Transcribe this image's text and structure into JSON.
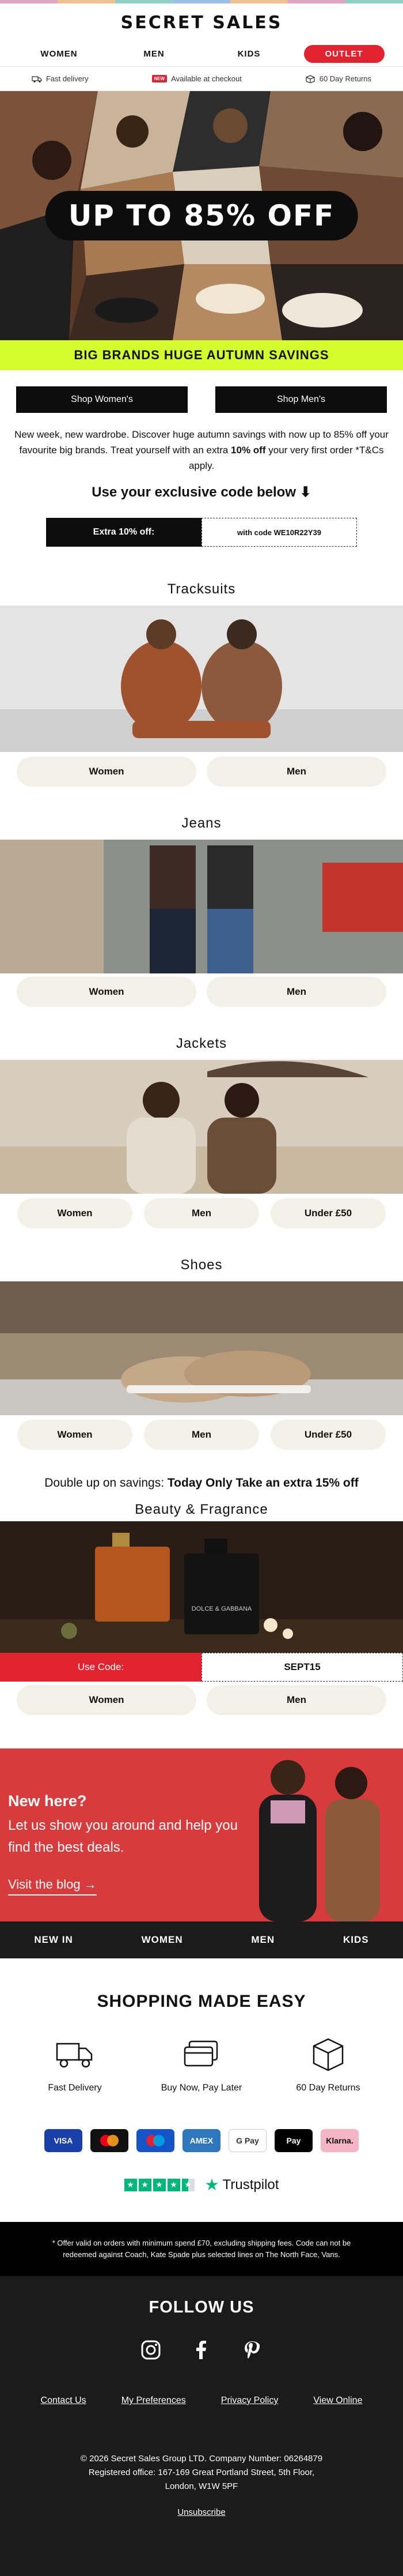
{
  "brand": {
    "logo": "SECRET SALES",
    "stripe_colors": [
      "#e3a3c6",
      "#f2c08f",
      "#8fd1c8",
      "#9cc0ea",
      "#f2c08f",
      "#e3a3c6",
      "#8fd1c8"
    ]
  },
  "nav": {
    "items": [
      {
        "label": "WOMEN"
      },
      {
        "label": "MEN"
      },
      {
        "label": "KIDS"
      },
      {
        "label": "OUTLET"
      }
    ]
  },
  "usp": {
    "fast_delivery": "Fast delivery",
    "new_badge": "NEW",
    "checkout": "Available at checkout",
    "returns": "60 Day Returns"
  },
  "hero": {
    "headline": "UP TO 85% OFF"
  },
  "banner": {
    "text": "BIG BRANDS HUGE AUTUMN SAVINGS"
  },
  "shop_buttons": {
    "women": "Shop Women's",
    "men": "Shop Men's"
  },
  "intro": {
    "text_a": "New week, new wardrobe. Discover huge autumn savings with now up to 85% off your favourite big brands. Treat yourself with an extra ",
    "text_bold": "10% off",
    "text_b": " your very first order *T&Cs apply.",
    "code_heading": "Use your exclusive code below ⬇"
  },
  "code_box": {
    "label": "Extra 10% off:",
    "code": "with code WE10R22Y39"
  },
  "sections": {
    "tracksuits": {
      "title": "Tracksuits",
      "buttons": [
        "Women",
        "Men"
      ]
    },
    "jeans": {
      "title": "Jeans",
      "buttons": [
        "Women",
        "Men"
      ]
    },
    "jackets": {
      "title": "Jackets",
      "buttons": [
        "Women",
        "Men",
        "Under £50"
      ]
    },
    "shoes": {
      "title": "Shoes",
      "buttons": [
        "Women",
        "Men",
        "Under £50"
      ]
    },
    "beauty": {
      "title": "Beauty & Fragrance",
      "buttons": [
        "Women",
        "Men"
      ]
    }
  },
  "double_up": {
    "lead": "Double up on savings: ",
    "bold": "Today Only Take an extra 15% off"
  },
  "beauty_code": {
    "label": "Use Code:",
    "code": "SEPT15",
    "bottle_brand": "DOLCE & GABBANA"
  },
  "new_here": {
    "title": "New here?",
    "body": "Let us show you around and help you find the best deals.",
    "link": "Visit the blog →"
  },
  "bottom_nav": [
    "NEW IN",
    "WOMEN",
    "MEN",
    "KIDS"
  ],
  "made_easy": {
    "title": "SHOPPING MADE EASY",
    "items": [
      "Fast Delivery",
      "Buy Now, Pay Later",
      "60 Day Returns"
    ]
  },
  "payments": [
    {
      "label": "VISA",
      "bg": "#1a3fa8"
    },
    {
      "label": "●●",
      "bg": "#111111"
    },
    {
      "label": "●●",
      "bg": "#1652c8"
    },
    {
      "label": "AMEX",
      "bg": "#2e77bc"
    },
    {
      "label": "G Pay",
      "bg": "#ffffff"
    },
    {
      "label": " Pay",
      "bg": "#000000"
    },
    {
      "label": "Klarna.",
      "bg": "#f5b5c6"
    }
  ],
  "trustpilot": {
    "name": "Trustpilot"
  },
  "terms": {
    "text": "* Offer valid on orders with minimum spend £70, excluding shipping fees. Code can not be redeemed against Coach, Kate Spade plus selected lines on The North Face, Vans."
  },
  "footer": {
    "follow": "FOLLOW US",
    "links": [
      "Contact Us",
      "My Preferences",
      "Privacy Policy",
      "View Online"
    ],
    "info": "© 2026 Secret Sales Group LTD. Company Number: 06264879 Registered office: 167-169 Great Portland Street, 5th Floor, London, W1W 5PF",
    "unsubscribe": "Unsubscribe"
  }
}
